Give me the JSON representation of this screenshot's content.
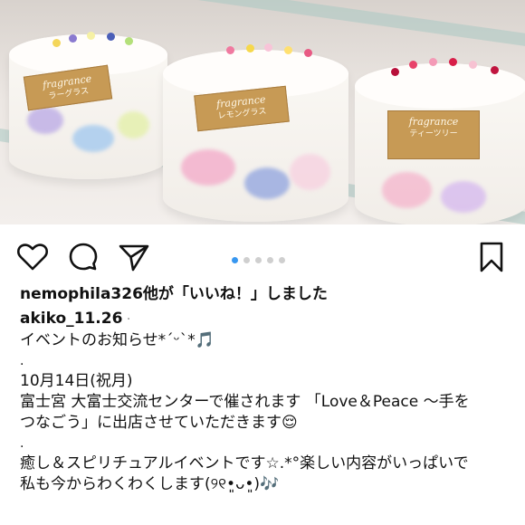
{
  "photo": {
    "candles": [
      {
        "tag_line1": "fragrance",
        "tag_line2": "ラーグラス"
      },
      {
        "tag_line1": "fragrance",
        "tag_line2": "レモングラス"
      },
      {
        "tag_line1": "fragrance",
        "tag_line2": "ティーツリー"
      }
    ]
  },
  "actions": {
    "like_icon": "heart-icon",
    "comment_icon": "comment-icon",
    "share_icon": "send-icon",
    "save_icon": "bookmark-icon"
  },
  "carousel": {
    "count": 5,
    "active": 1
  },
  "likes": {
    "user": "nemophila326",
    "text": "他が「いいね！」しました"
  },
  "caption": {
    "author": "akiko_11.26",
    "sep": " ·",
    "line1": "イベントのお知らせ*´ᵕ`*🎵",
    "dot1": ".",
    "date": "10月14日(祝月)",
    "line3": "富士宮 大富士交流センターで催されます 「Love＆Peace 〜手を",
    "line4": "つなごう」に出店させていただきます😌",
    "dot2": ".",
    "line5": "癒し＆スピリチュアルイベントです☆.*°楽しい内容がいっぱいで",
    "line6": "私も今からわくわくします(୨୧•͈ᴗ•͈)🎶"
  }
}
